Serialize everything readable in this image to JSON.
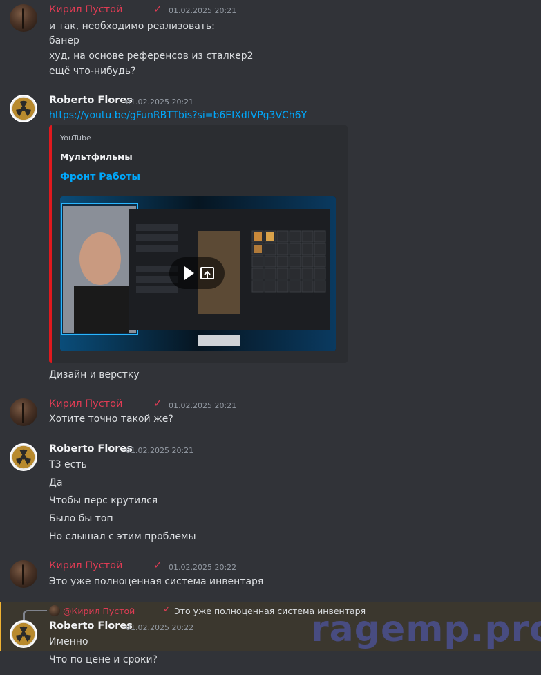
{
  "messages": {
    "m1": {
      "author": "Кирил Пустой",
      "time": "01.02.2025 20:21",
      "lines": [
        "и так, необходимо реализовать:",
        "банер",
        "худ, на основе референсов из сталкер2",
        "ещё что-нибудь?"
      ]
    },
    "m2": {
      "author": "Roberto Flores",
      "time": "01.02.2025 20:21",
      "link": "https://youtu.be/gFunRBTTbis?si=b6EIXdfVPg3VCh6Y",
      "embed": {
        "provider": "YouTube",
        "author": "Мультфильмы",
        "title": "Фронт Работы"
      },
      "lines": [
        "Дизайн и верстку"
      ]
    },
    "m3": {
      "author": "Кирил Пустой",
      "time": "01.02.2025 20:21",
      "lines": [
        "Хотите точно такой же?"
      ]
    },
    "m4": {
      "author": "Roberto Flores",
      "time": "01.02.2025 20:21",
      "lines": [
        "ТЗ есть",
        "Да",
        "Чтобы перс крутился",
        "Было бы топ",
        "Но слышал с этим проблемы"
      ]
    },
    "m5": {
      "author": "Кирил Пустой",
      "time": "01.02.2025 20:22",
      "lines": [
        "Это уже полноценная система инвентаря"
      ]
    },
    "m6": {
      "reply": {
        "mention": "@Кирил Пустой",
        "text": "Это уже полноценная система инвентаря"
      },
      "author": "Roberto Flores",
      "time": "01.02.2025 20:22",
      "lines": [
        "Именно",
        "Что по цене и сроки?"
      ]
    }
  },
  "check_glyph": "✓",
  "watermark": "ragemp.pro",
  "colors": {
    "background": "#313338",
    "kiril_name": "#e03c54",
    "link": "#00a8fc",
    "embed_border": "#e0191e",
    "reply_highlight": "#3b372e"
  },
  "icons": [
    "play-icon",
    "open-external-icon",
    "radiation-icon"
  ]
}
